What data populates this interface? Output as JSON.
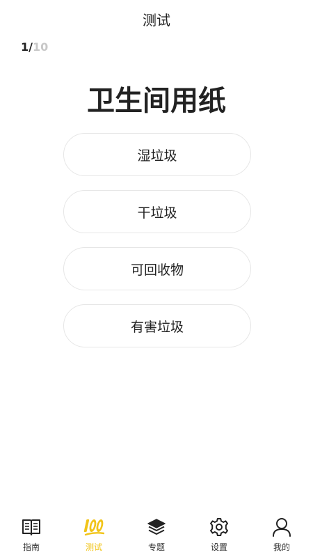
{
  "header": {
    "title": "测试"
  },
  "progress": {
    "current": "1",
    "separator": "/",
    "total": "10"
  },
  "question": {
    "text": "卫生间用纸"
  },
  "options": [
    {
      "label": "湿垃圾"
    },
    {
      "label": "干垃圾"
    },
    {
      "label": "可回收物"
    },
    {
      "label": "有害垃圾"
    }
  ],
  "tabbar": {
    "items": [
      {
        "label": "指南",
        "icon": "book-icon"
      },
      {
        "label": "测试",
        "icon": "hundred-points-icon",
        "active": true
      },
      {
        "label": "专题",
        "icon": "layers-icon"
      },
      {
        "label": "设置",
        "icon": "gear-icon"
      },
      {
        "label": "我的",
        "icon": "user-icon"
      }
    ]
  },
  "colors": {
    "accent": "#f1c418",
    "text": "#222222",
    "muted": "#c8c8c8",
    "border": "#e6e6e6"
  }
}
